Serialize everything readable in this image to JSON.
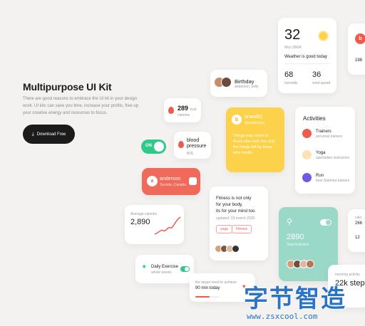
{
  "hero": {
    "title": "Multipurpose UI Kit",
    "line1": "There are good reasons to embrace the UI kit in your design",
    "line2": "work. UI kits can save you time, increase your profits, free up",
    "line3": "your creative energy and resources to focus.",
    "button": "Download Free"
  },
  "birthday": {
    "title": "Birthday",
    "sub": "anderson, kelly"
  },
  "calories_small": {
    "value": "289",
    "unit": "kcal",
    "label": "calories"
  },
  "blood": {
    "line1": "blood",
    "line2": "pressure",
    "sub": "BOL"
  },
  "toggle": {
    "label": "ON"
  },
  "anderson": {
    "name": "anderson",
    "sub": "Toronto, Canada"
  },
  "brand": {
    "name": "brand91",
    "handle": "@stardesign",
    "letter": "b",
    "line1": "Things may come to",
    "line2": "those who wait, but only",
    "line3": "the things left by those",
    "line4": "who hustle."
  },
  "weather": {
    "temp": "32",
    "date": "Mon 28/04",
    "summary": "Weather is good today",
    "humidity_value": "68",
    "humidity_label": "humidity",
    "wind_value": "36",
    "wind_label": "wind speed"
  },
  "edge_b": {
    "letter": "b",
    "value": "198"
  },
  "activities": {
    "title": "Activities",
    "items": [
      {
        "name": "Trainers",
        "sub": "personal trainers"
      },
      {
        "name": "Yoga",
        "sub": "specialists instructors"
      },
      {
        "name": "Run",
        "sub": "best Stamina trainers"
      }
    ]
  },
  "avg_cal": {
    "label": "Average calories",
    "value": "2,890"
  },
  "fitness": {
    "line1": "Fitness is not only",
    "line2": "for your body,",
    "line3": "its for your mind too.",
    "updated": "updated: 23 march 2020",
    "tag1": "yoga",
    "tag2": "Fitness"
  },
  "cycling": {
    "value": "2890",
    "label": "Total Activities"
  },
  "edge_cal": {
    "label": "calo",
    "v1": "266",
    "v2": "12"
  },
  "daily": {
    "title": "Daily Exercise",
    "sub": "whole weeks"
  },
  "target": {
    "line1": "the target need to achieve",
    "value": "90 min today"
  },
  "morning": {
    "label": "morning activity",
    "value": "22k steps"
  },
  "watermark": {
    "cn": "字节智造",
    "url": "www.zsxcool.com"
  },
  "colors": {
    "red": "#ef5a4c",
    "yellow": "#fcd24b",
    "green": "#2fc98a",
    "teal": "#9ad8c8",
    "purple": "#6d5be8",
    "orange": "#f7a64c",
    "watermark_blue": "#2a73c7"
  }
}
